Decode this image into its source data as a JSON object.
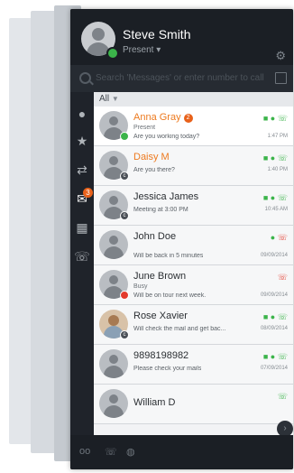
{
  "user": {
    "name": "Steve Smith",
    "presence": "Present ▾"
  },
  "search": {
    "placeholder": "Search 'Messages' or enter number to call"
  },
  "filter": {
    "label": "All"
  },
  "nav": {
    "chat_badge": "3"
  },
  "contacts": [
    {
      "name": "Anna Gray",
      "sub": "Present",
      "message": "Are you working today?",
      "time": "1:47 PM",
      "unread": "2"
    },
    {
      "name": "Daisy M",
      "message": "Are you there?",
      "time": "1:40 PM"
    },
    {
      "name": "Jessica James",
      "message": "Meeting at 3:00 PM",
      "time": "10:45 AM"
    },
    {
      "name": "John Doe",
      "message": "Will be back in 5 minutes",
      "time": "09/09/2014"
    },
    {
      "name": "June Brown",
      "sub": "Busy",
      "message": "Will be on tour next week.",
      "time": "09/09/2014"
    },
    {
      "name": "Rose Xavier",
      "message": "Will check the mail and get bac...",
      "time": "08/09/2014"
    },
    {
      "name": "9898198982",
      "message": "Please check your mails",
      "time": "07/09/2014"
    },
    {
      "name": "William D"
    }
  ],
  "colors": {
    "accent": "#ed7a1f",
    "online": "#3bb44a",
    "busy": "#e33a2c"
  },
  "icons": [
    "gear-icon",
    "search-icon",
    "compose-icon",
    "contacts-icon",
    "favorites-icon",
    "transfer-icon",
    "chat-icon",
    "dialpad-icon",
    "phone-icon",
    "video-icon",
    "voicemail-icon"
  ]
}
